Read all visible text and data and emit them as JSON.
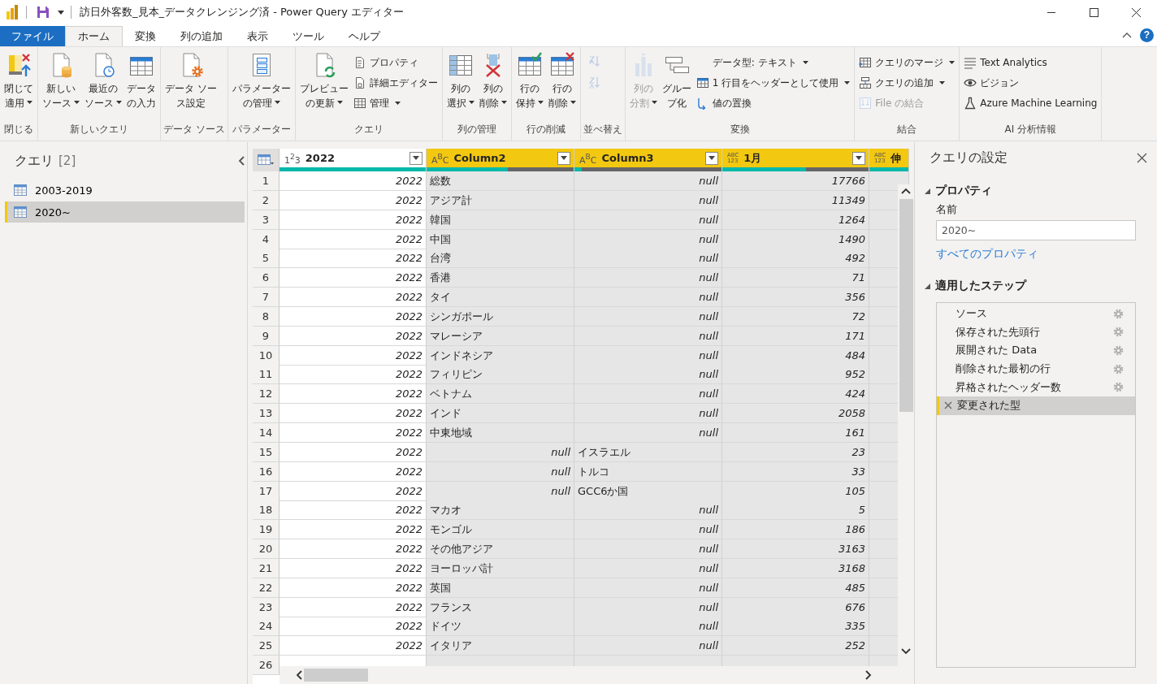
{
  "window": {
    "title": "訪日外客数_見本_データクレンジング済 - Power Query エディター"
  },
  "ribbon_tabs": [
    {
      "label": "ファイル",
      "kind": "file",
      "selected": false
    },
    {
      "label": "ホーム",
      "kind": "tab",
      "selected": true
    },
    {
      "label": "変換",
      "kind": "tab",
      "selected": false
    },
    {
      "label": "列の追加",
      "kind": "tab",
      "selected": false
    },
    {
      "label": "表示",
      "kind": "tab",
      "selected": false
    },
    {
      "label": "ツール",
      "kind": "tab",
      "selected": false
    },
    {
      "label": "ヘルプ",
      "kind": "tab",
      "selected": false
    }
  ],
  "help": "?",
  "ribbon_groups": [
    {
      "label": "閉じる",
      "items": [
        {
          "kind": "large",
          "label_lines": [
            "閉じて",
            "適用"
          ],
          "dropdown": true,
          "disabled": false
        }
      ]
    },
    {
      "label": "新しいクエリ",
      "items": [
        {
          "kind": "large",
          "label_lines": [
            "新しい",
            "ソース"
          ],
          "dropdown": true,
          "disabled": false
        },
        {
          "kind": "large",
          "label_lines": [
            "最近の",
            "ソース"
          ],
          "dropdown": true,
          "disabled": false
        },
        {
          "kind": "large",
          "label_lines": [
            "データ",
            "の入力"
          ],
          "dropdown": false,
          "disabled": false
        }
      ]
    },
    {
      "label": "データ ソース",
      "items": [
        {
          "kind": "large",
          "label_lines": [
            "データ ソー",
            "ス設定"
          ],
          "dropdown": false,
          "disabled": false
        }
      ]
    },
    {
      "label": "パラメーター",
      "items": [
        {
          "kind": "large",
          "label_lines": [
            "パラメーター",
            "の管理"
          ],
          "dropdown": true,
          "disabled": false
        }
      ]
    },
    {
      "label": "クエリ",
      "items": [
        {
          "kind": "large",
          "label_lines": [
            "プレビュー",
            "の更新"
          ],
          "dropdown": true,
          "disabled": false
        },
        {
          "kind": "small",
          "label": "プロパティ",
          "dropdown": false,
          "disabled": false
        },
        {
          "kind": "small",
          "label": "詳細エディター",
          "dropdown": false,
          "disabled": false
        },
        {
          "kind": "small",
          "label": "管理",
          "dropdown": true,
          "disabled": false
        }
      ]
    },
    {
      "label": "列の管理",
      "items": [
        {
          "kind": "large",
          "label_lines": [
            "列の",
            "選択"
          ],
          "dropdown": true,
          "disabled": false
        },
        {
          "kind": "large",
          "label_lines": [
            "列の",
            "削除"
          ],
          "dropdown": true,
          "disabled": false
        }
      ]
    },
    {
      "label": "行の削減",
      "items": [
        {
          "kind": "large",
          "label_lines": [
            "行の",
            "保持"
          ],
          "dropdown": true,
          "disabled": false
        },
        {
          "kind": "large",
          "label_lines": [
            "行の",
            "削除"
          ],
          "dropdown": true,
          "disabled": false
        }
      ]
    },
    {
      "label": "並べ替え",
      "items": [
        {
          "kind": "icon",
          "dropdown": false,
          "disabled": true
        },
        {
          "kind": "icon",
          "dropdown": false,
          "disabled": true
        }
      ]
    },
    {
      "label": "変換",
      "items": [
        {
          "kind": "large",
          "label_lines": [
            "列の",
            "分割"
          ],
          "dropdown": true,
          "disabled": true
        },
        {
          "kind": "large",
          "label_lines": [
            "グルー",
            "プ化"
          ],
          "dropdown": false,
          "disabled": false
        },
        {
          "kind": "small",
          "label": "データ型: テキスト",
          "dropdown": true,
          "disabled": false
        },
        {
          "kind": "small",
          "label": "1 行目をヘッダーとして使用",
          "dropdown": true,
          "disabled": false
        },
        {
          "kind": "small",
          "label": "値の置換",
          "dropdown": false,
          "disabled": false
        }
      ]
    },
    {
      "label": "結合",
      "items": [
        {
          "kind": "small",
          "label": "クエリのマージ",
          "dropdown": true,
          "disabled": false
        },
        {
          "kind": "small",
          "label": "クエリの追加",
          "dropdown": true,
          "disabled": false
        },
        {
          "kind": "small",
          "label": "File の結合",
          "dropdown": false,
          "disabled": true
        }
      ]
    },
    {
      "label": "AI 分析情報",
      "items": [
        {
          "kind": "small",
          "label": "Text Analytics",
          "dropdown": false,
          "disabled": false
        },
        {
          "kind": "small",
          "label": "ビジョン",
          "dropdown": false,
          "disabled": false
        },
        {
          "kind": "small",
          "label": "Azure Machine Learning",
          "dropdown": false,
          "disabled": false
        }
      ]
    }
  ],
  "queries_pane": {
    "title": "クエリ",
    "count": "[2]",
    "items": [
      {
        "label": "2003-2019",
        "selected": false
      },
      {
        "label": "2020~",
        "selected": true
      }
    ]
  },
  "table": {
    "columns": [
      {
        "name": "2022",
        "type_label": "1$^{2}$3",
        "kind": "number",
        "selected": false,
        "level": 1
      },
      {
        "name": "Column2",
        "type_label": "A$^{B}$C",
        "kind": "text",
        "selected": true,
        "level": 0.55
      },
      {
        "name": "Column3",
        "type_label": "A$^{B}$C",
        "kind": "text",
        "selected": true,
        "level": 0.05
      },
      {
        "name": "1月",
        "type_label": "ABC\n123",
        "kind": "any",
        "selected": true,
        "level": 0.57
      },
      {
        "name": "伸",
        "type_label": "ABC\n123",
        "kind": "any",
        "selected": true
      }
    ],
    "rows": [
      {
        "number": "1",
        "cells": [
          "2022",
          "総数",
          {
            "kind": "null",
            "text": "null"
          },
          "17766"
        ]
      },
      {
        "number": "2",
        "cells": [
          "2022",
          "アジア計",
          {
            "kind": "null",
            "text": "null"
          },
          "11349"
        ]
      },
      {
        "number": "3",
        "cells": [
          "2022",
          "韓国",
          {
            "kind": "null",
            "text": "null"
          },
          "1264"
        ]
      },
      {
        "number": "4",
        "cells": [
          "2022",
          "中国",
          {
            "kind": "null",
            "text": "null"
          },
          "1490"
        ]
      },
      {
        "number": "5",
        "cells": [
          "2022",
          "台湾",
          {
            "kind": "null",
            "text": "null"
          },
          "492"
        ]
      },
      {
        "number": "6",
        "cells": [
          "2022",
          "香港",
          {
            "kind": "null",
            "text": "null"
          },
          "71"
        ]
      },
      {
        "number": "7",
        "cells": [
          "2022",
          "タイ",
          {
            "kind": "null",
            "text": "null"
          },
          "356"
        ]
      },
      {
        "number": "8",
        "cells": [
          "2022",
          "シンガポール",
          {
            "kind": "null",
            "text": "null"
          },
          "72"
        ]
      },
      {
        "number": "9",
        "cells": [
          "2022",
          "マレーシア",
          {
            "kind": "null",
            "text": "null"
          },
          "171"
        ]
      },
      {
        "number": "10",
        "cells": [
          "2022",
          "インドネシア",
          {
            "kind": "null",
            "text": "null"
          },
          "484"
        ]
      },
      {
        "number": "11",
        "cells": [
          "2022",
          "フィリピン",
          {
            "kind": "null",
            "text": "null"
          },
          "952"
        ]
      },
      {
        "number": "12",
        "cells": [
          "2022",
          "ベトナム",
          {
            "kind": "null",
            "text": "null"
          },
          "424"
        ]
      },
      {
        "number": "13",
        "cells": [
          "2022",
          "インド",
          {
            "kind": "null",
            "text": "null"
          },
          "2058"
        ]
      },
      {
        "number": "14",
        "cells": [
          "2022",
          "中東地域",
          {
            "kind": "null",
            "text": "null"
          },
          "161"
        ]
      },
      {
        "number": "15",
        "cells": [
          "2022",
          {
            "kind": "null",
            "text": "null"
          },
          "イスラエル",
          "23"
        ]
      },
      {
        "number": "16",
        "cells": [
          "2022",
          {
            "kind": "null",
            "text": "null"
          },
          "トルコ",
          "33"
        ]
      },
      {
        "number": "17",
        "cells": [
          "2022",
          {
            "kind": "null",
            "text": "null"
          },
          "GCC6か国",
          "105"
        ]
      },
      {
        "number": "18",
        "cells": [
          "2022",
          "マカオ",
          {
            "kind": "null",
            "text": "null"
          },
          "5"
        ]
      },
      {
        "number": "19",
        "cells": [
          "2022",
          "モンゴル",
          {
            "kind": "null",
            "text": "null"
          },
          "186"
        ]
      },
      {
        "number": "20",
        "cells": [
          "2022",
          "その他アジア",
          {
            "kind": "null",
            "text": "null"
          },
          "3163"
        ]
      },
      {
        "number": "21",
        "cells": [
          "2022",
          "ヨーロッパ計",
          {
            "kind": "null",
            "text": "null"
          },
          "3168"
        ]
      },
      {
        "number": "22",
        "cells": [
          "2022",
          "英国",
          {
            "kind": "null",
            "text": "null"
          },
          "485"
        ]
      },
      {
        "number": "23",
        "cells": [
          "2022",
          "フランス",
          {
            "kind": "null",
            "text": "null"
          },
          "676"
        ]
      },
      {
        "number": "24",
        "cells": [
          "2022",
          "ドイツ",
          {
            "kind": "null",
            "text": "null"
          },
          "335"
        ]
      },
      {
        "number": "25",
        "cells": [
          "2022",
          "イタリア",
          {
            "kind": "null",
            "text": "null"
          },
          "252"
        ]
      },
      {
        "number": "26"
      }
    ]
  },
  "settings_pane": {
    "title": "クエリの設定",
    "properties": {
      "title": "プロパティ",
      "expanded": true,
      "name_label": "名前",
      "name_value": "2020~",
      "link": "すべてのプロパティ"
    },
    "steps_section": {
      "title": "適用したステップ",
      "expanded": true,
      "steps": [
        {
          "label": "ソース",
          "settings": true,
          "selected": false
        },
        {
          "label": "保存された先頭行",
          "settings": true,
          "selected": false
        },
        {
          "label": "展開された Data",
          "settings": true,
          "selected": false
        },
        {
          "label": "削除された最初の行",
          "settings": true,
          "selected": false
        },
        {
          "label": "昇格されたヘッダー数",
          "settings": true,
          "selected": false
        },
        {
          "label": "変更された型",
          "settings": false,
          "selected": true
        }
      ]
    }
  }
}
